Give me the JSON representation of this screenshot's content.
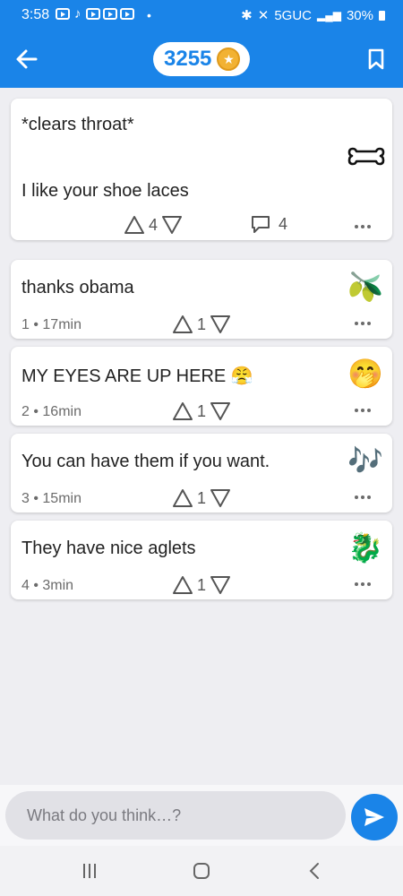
{
  "status_bar": {
    "time": "3:58",
    "network": "5GUC",
    "battery": "30%"
  },
  "header": {
    "score": "3255",
    "back_icon": "arrow-left-icon",
    "bookmark_icon": "bookmark-icon",
    "coin_icon": "star-coin-icon"
  },
  "post": {
    "line1": "*clears throat*",
    "line2": "I like your shoe laces",
    "avatar_icon": "bone-icon",
    "votes": "4",
    "comments": "4"
  },
  "replies": [
    {
      "text": "thanks obama",
      "meta": "1 • 17min",
      "votes": "1",
      "emoji": "🫒",
      "emoji_name": "olive-icon"
    },
    {
      "text": "MY EYES ARE UP HERE 😤",
      "meta": "2 • 16min",
      "votes": "1",
      "emoji": "🤭",
      "emoji_name": "hand-over-mouth-icon"
    },
    {
      "text": "You can have them if you want.",
      "meta": "3 • 15min",
      "votes": "1",
      "emoji": "🎶",
      "emoji_name": "music-notes-icon"
    },
    {
      "text": "They have nice aglets",
      "meta": "4 • 3min",
      "votes": "1",
      "emoji": "🐉",
      "emoji_name": "dragon-icon"
    }
  ],
  "composer": {
    "placeholder": "What do you think…?"
  },
  "colors": {
    "accent": "#1a84e8",
    "background": "#eeeef2"
  }
}
